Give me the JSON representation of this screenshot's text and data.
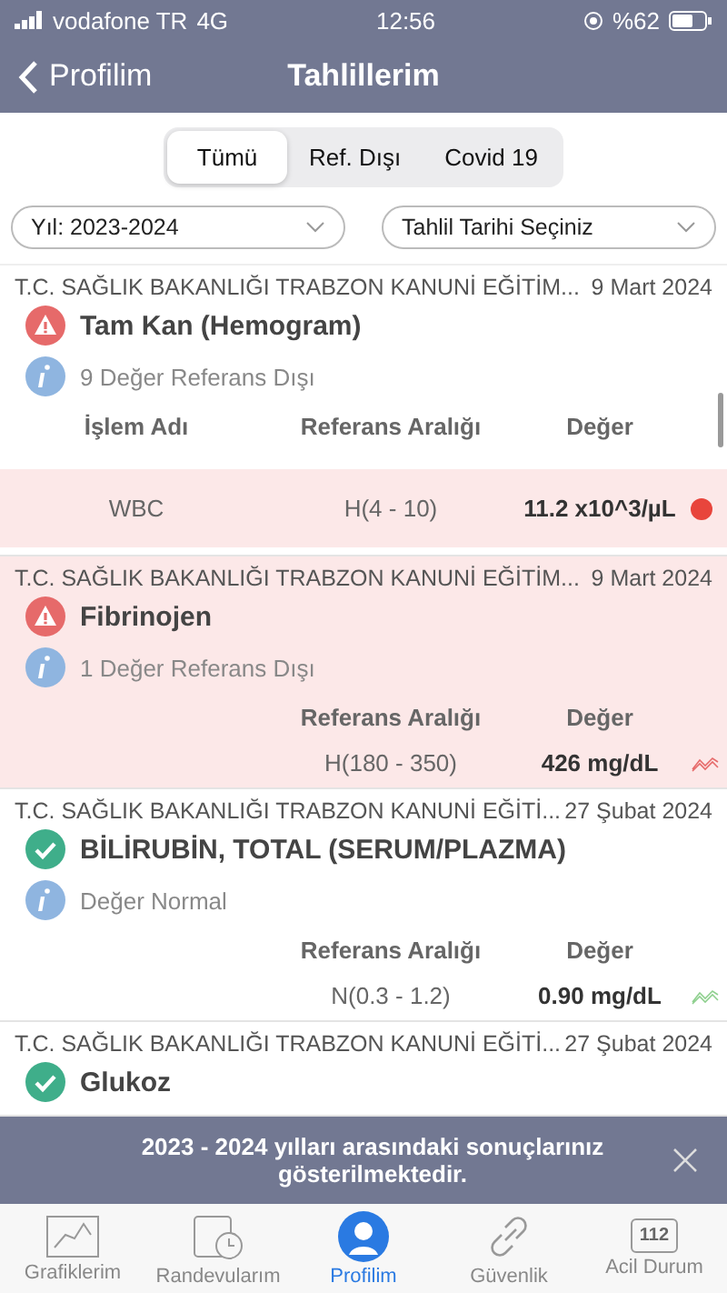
{
  "status_bar": {
    "carrier": "vodafone TR",
    "network": "4G",
    "time": "12:56",
    "battery": "%62"
  },
  "nav": {
    "back": "Profilim",
    "title": "Tahlillerim"
  },
  "segments": [
    {
      "label": "Tümü",
      "selected": true
    },
    {
      "label": "Ref. Dışı",
      "selected": false
    },
    {
      "label": "Covid 19",
      "selected": false
    }
  ],
  "filters": [
    {
      "value": "Yıl: 2023-2024"
    },
    {
      "value": "Tahlil Tarihi Seçiniz"
    }
  ],
  "results": [
    {
      "hospital": "T.C. SAĞLIK BAKANLIĞI TRABZON KANUNİ EĞİTİM...",
      "date": "9 Mart 2024",
      "kind": "warning",
      "title": "Tam Kan (Hemogram)",
      "info": "9 Değer Referans Dışı",
      "highlighted": false,
      "columns": [
        "İşlem Adı",
        "Referans Aralığı",
        "Değer"
      ],
      "rows": [
        {
          "name": "WBC",
          "range": "H(4 - 10)",
          "value": "11.2 x10^3/µL",
          "highlighted": true,
          "kind": "dot"
        }
      ]
    },
    {
      "hospital": "T.C. SAĞLIK BAKANLIĞI TRABZON KANUNİ EĞİTİM...",
      "date": "9 Mart 2024",
      "kind": "warning",
      "title": "Fibrinojen",
      "info": "1 Değer Referans Dışı",
      "highlighted": true,
      "columns": [
        "Referans Aralığı",
        "Değer"
      ],
      "rows": [
        {
          "range": "H(180 - 350)",
          "value": "426 mg/dL",
          "highlighted": false,
          "kind": "trend",
          "color": "#e66a6a"
        }
      ]
    },
    {
      "hospital": "T.C. SAĞLIK BAKANLIĞI TRABZON KANUNİ EĞİTİ...",
      "date": "27 Şubat 2024",
      "kind": "normal",
      "title": "BİLİRUBİN, TOTAL (SERUM/PLAZMA)",
      "info": "Değer Normal",
      "highlighted": false,
      "columns": [
        "Referans Aralığı",
        "Değer"
      ],
      "rows": [
        {
          "range": "N(0.3 - 1.2)",
          "value": "0.90 mg/dL",
          "highlighted": false,
          "kind": "trend",
          "color": "#8fd08f"
        }
      ]
    },
    {
      "hospital": "T.C. SAĞLIK BAKANLIĞI TRABZON KANUNİ EĞİTİ...",
      "date": "27 Şubat 2024",
      "kind": "normal",
      "title": "Glukoz",
      "highlighted": false
    }
  ],
  "banner": {
    "text": "2023 - 2024 yılları arasındaki sonuçlarınız gösterilmektedir."
  },
  "tabbar": [
    {
      "kind": "charts",
      "label": "Grafiklerim",
      "selected": false
    },
    {
      "kind": "calendar",
      "label": "Randevularım",
      "selected": false
    },
    {
      "kind": "profile",
      "label": "Profilim",
      "selected": true
    },
    {
      "kind": "link",
      "label": "Güvenlik",
      "selected": false
    },
    {
      "kind": "emergency",
      "label": "Acil Durum",
      "badge": "112",
      "selected": false
    }
  ]
}
